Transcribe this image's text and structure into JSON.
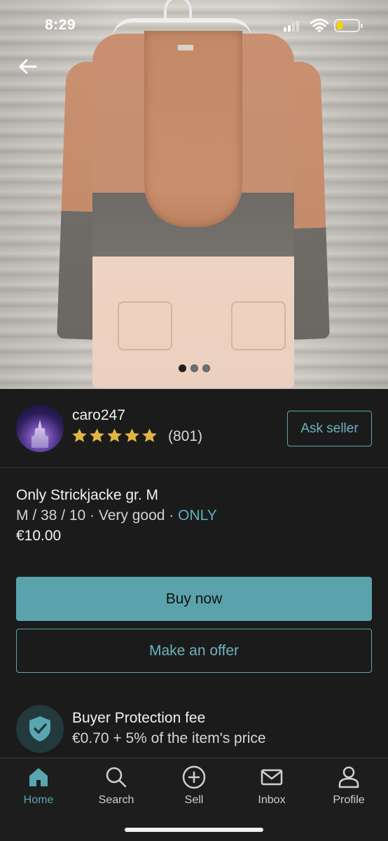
{
  "status_bar": {
    "time": "8:29"
  },
  "gallery": {
    "photo_count": 3,
    "active_index": 0
  },
  "seller": {
    "name": "caro247",
    "rating_stars": 5,
    "rating_count": "(801)",
    "ask_button": "Ask seller"
  },
  "item": {
    "title": "Only Strickjacke gr. M",
    "meta_prefix": "M / 38 / 10 · Very good · ",
    "brand": "ONLY",
    "price": "€10.00"
  },
  "actions": {
    "buy_now": "Buy now",
    "make_offer": "Make an offer"
  },
  "buyer_protection": {
    "title": "Buyer Protection fee",
    "description": "€0.70 + 5% of the item's price"
  },
  "tabs": [
    {
      "label": "Home",
      "icon": "home-icon",
      "active": true
    },
    {
      "label": "Search",
      "icon": "search-icon",
      "active": false
    },
    {
      "label": "Sell",
      "icon": "plus-circle-icon",
      "active": false
    },
    {
      "label": "Inbox",
      "icon": "mail-icon",
      "active": false
    },
    {
      "label": "Profile",
      "icon": "profile-icon",
      "active": false
    }
  ],
  "colors": {
    "accent": "#5aa6b0",
    "background": "#1b1b1b",
    "star": "#e3b545"
  }
}
